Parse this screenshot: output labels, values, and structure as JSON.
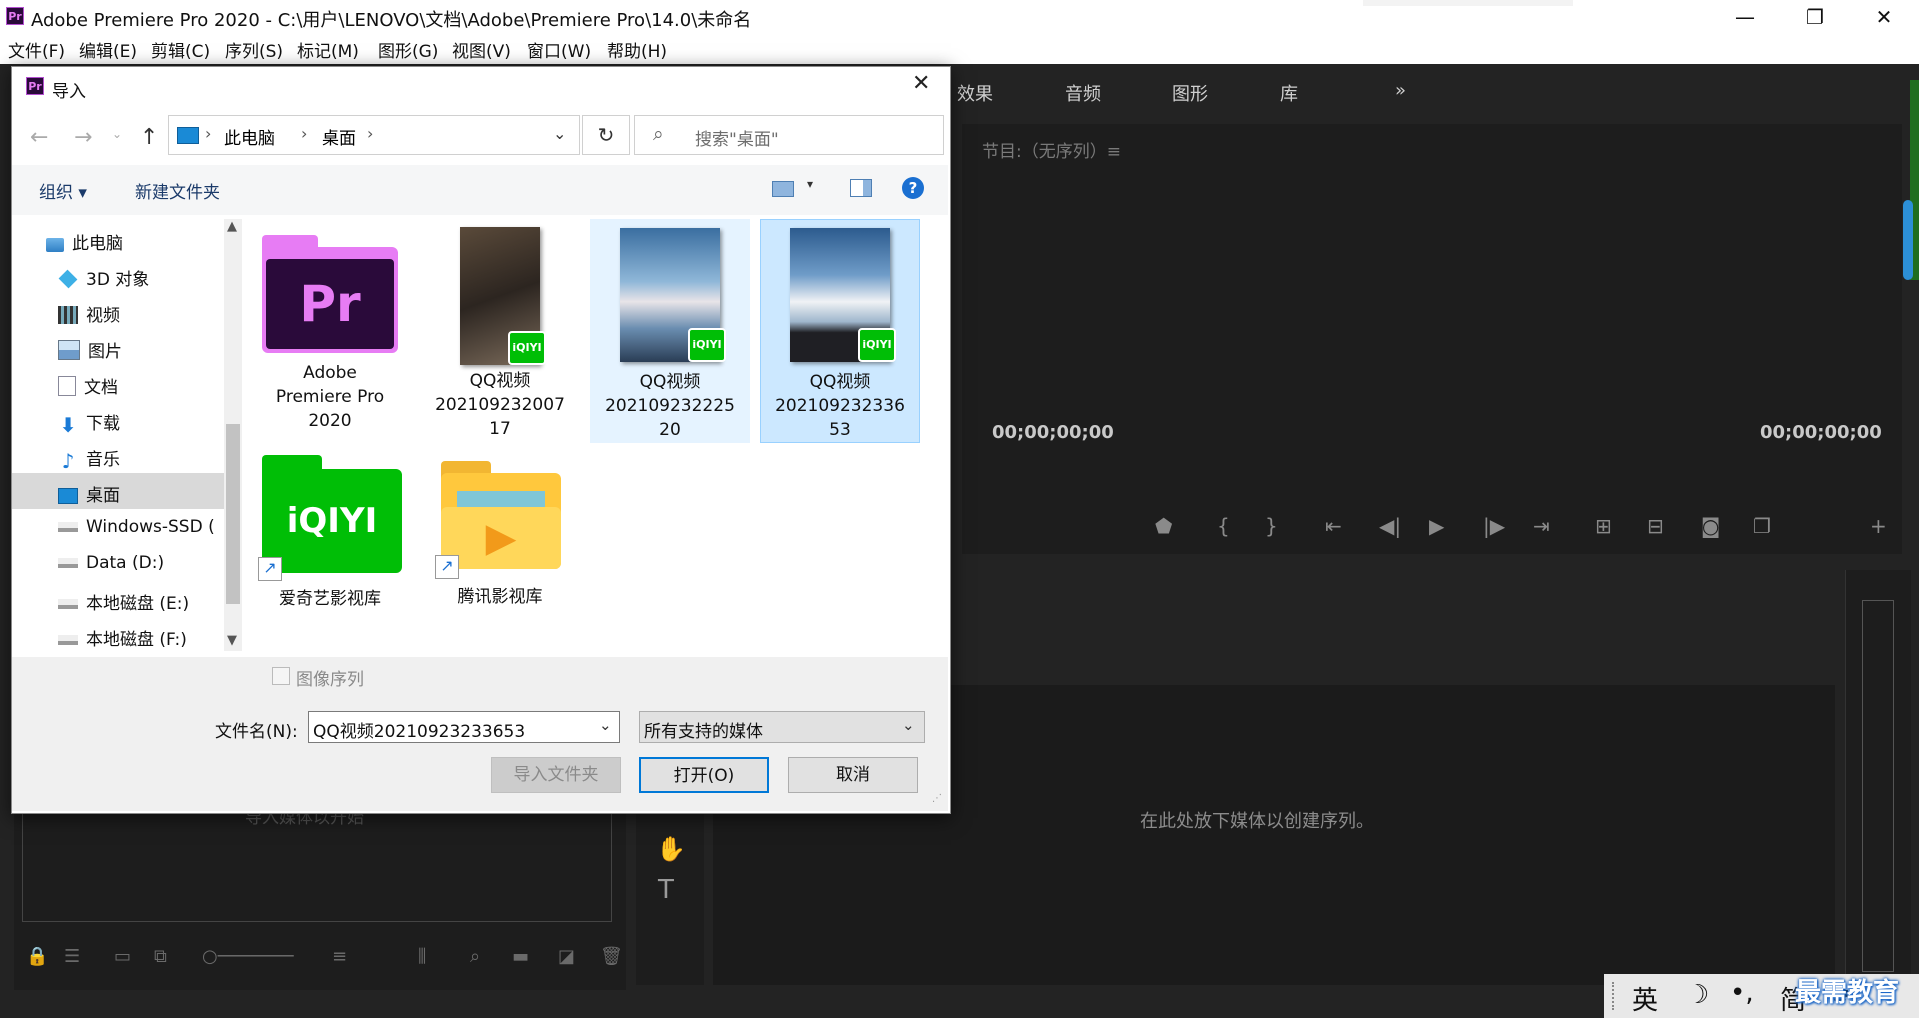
{
  "window": {
    "title": "Adobe Premiere Pro 2020 - C:\\用户\\LENOVO\\文档\\Adobe\\Premiere Pro\\14.0\\未命名",
    "app_icon": "Pr",
    "minimize": "—",
    "maximize": "❐",
    "close": "✕"
  },
  "menubar": [
    "文件(F)",
    "编辑(E)",
    "剪辑(C)",
    "序列(S)",
    "标记(M)",
    "图形(G)",
    "视图(V)",
    "窗口(W)",
    "帮助(H)"
  ],
  "workspace_tabs": [
    "效果",
    "音频",
    "图形",
    "库",
    "»"
  ],
  "program_monitor": {
    "title": "节目:（无序列）≡",
    "timecode_left": "00;00;00;00",
    "timecode_right": "00;00;00;00"
  },
  "project_panel": {
    "hint": "导入媒体以开始"
  },
  "timeline": {
    "drop_hint": "在此处放下媒体以创建序列。"
  },
  "dialog": {
    "title": "导入",
    "breadcrumb": [
      "此电脑",
      "桌面"
    ],
    "search_placeholder": "搜索\"桌面\"",
    "toolbar": {
      "organize": "组织 ▾",
      "new_folder": "新建文件夹"
    },
    "nav_items": [
      {
        "label": "此电脑",
        "icon": "computer-icon"
      },
      {
        "label": "3D 对象",
        "icon": "cube-icon"
      },
      {
        "label": "视频",
        "icon": "video-folder-icon"
      },
      {
        "label": "图片",
        "icon": "picture-folder-icon"
      },
      {
        "label": "文档",
        "icon": "document-folder-icon"
      },
      {
        "label": "下载",
        "icon": "download-icon"
      },
      {
        "label": "音乐",
        "icon": "music-icon"
      },
      {
        "label": "桌面",
        "icon": "desktop-icon"
      },
      {
        "label": "Windows-SSD (",
        "icon": "drive-icon"
      },
      {
        "label": "Data (D:)",
        "icon": "drive-icon"
      },
      {
        "label": "本地磁盘 (E:)",
        "icon": "drive-icon"
      },
      {
        "label": "本地磁盘 (F:)",
        "icon": "drive-icon"
      }
    ],
    "files": [
      {
        "label": "Adobe Premiere Pro 2020",
        "lines": [
          "Adobe",
          "Premiere Pro",
          "2020"
        ],
        "type": "premiere"
      },
      {
        "label": "QQ视频20210923200717",
        "lines": [
          "QQ视频",
          "202109232007",
          "17"
        ],
        "type": "video1"
      },
      {
        "label": "QQ视频20210923222520",
        "lines": [
          "QQ视频",
          "202109232225",
          "20"
        ],
        "type": "video2"
      },
      {
        "label": "QQ视频20210923233653",
        "lines": [
          "QQ视频",
          "202109232336",
          "53"
        ],
        "type": "video3"
      },
      {
        "label": "爱奇艺影视库",
        "lines": [
          "爱奇艺影视库"
        ],
        "type": "iqiyi"
      },
      {
        "label": "腾讯影视库",
        "lines": [
          "腾讯影视库"
        ],
        "type": "tencent"
      }
    ],
    "image_sequence_label": "图像序列",
    "filename_label": "文件名(N):",
    "filename_value": "QQ视频20210923233653",
    "filetype_value": "所有支持的媒体",
    "import_folder_button": "导入文件夹",
    "open_button": "打开(O)",
    "cancel_button": "取消"
  },
  "ime": {
    "lang": "英",
    "moon": "☽",
    "punct": "•,",
    "simp": "简",
    "gear": "⚙"
  },
  "watermark": "最需教育",
  "colors": {
    "premiere_bg": "#232323",
    "selection": "#cce8ff",
    "accent_blue": "#0078d7",
    "iqiyi_green": "#00be06",
    "premiere_purple": "#e77cf4"
  }
}
